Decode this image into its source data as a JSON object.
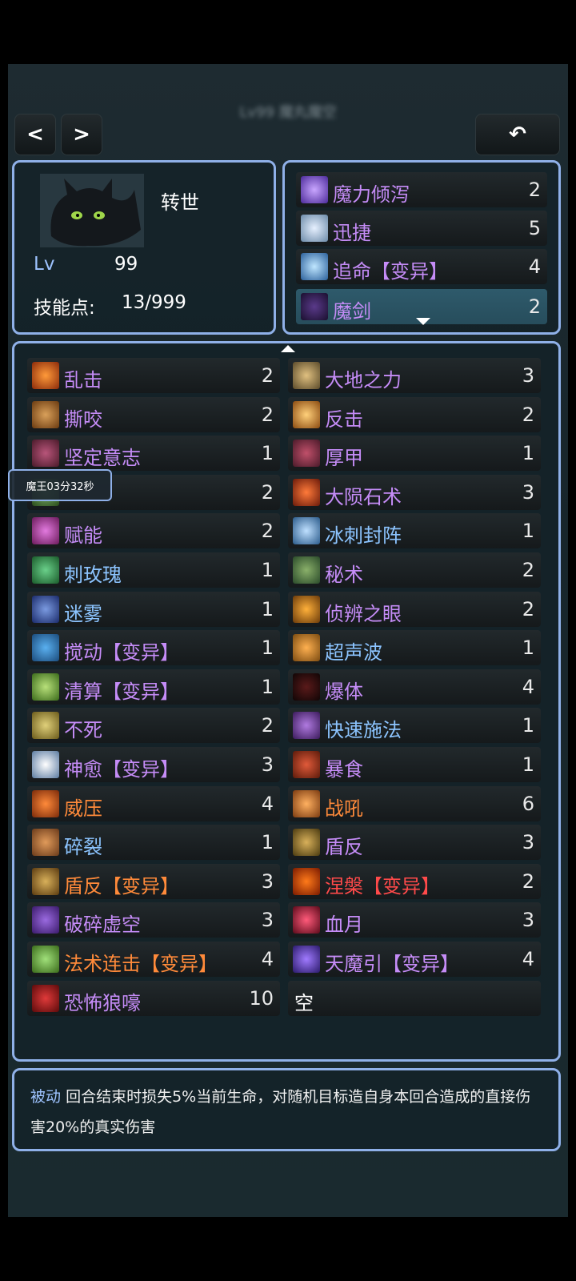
{
  "header": {
    "title": "Lv99 魔丸魔空"
  },
  "nav": {
    "prev": "<",
    "next": ">",
    "back": "↶"
  },
  "hero": {
    "rebirth": "转世",
    "lv_label": "Lv",
    "lv_value": "99",
    "sp_label": "技能点:",
    "sp_value": "13/999"
  },
  "active_skills": [
    {
      "name": "魔力倾泻",
      "count": "2",
      "color": "purple",
      "icon": "vortex-icon"
    },
    {
      "name": "迅捷",
      "count": "5",
      "color": "purple",
      "icon": "swift-icon"
    },
    {
      "name": "追命【变异】",
      "count": "4",
      "color": "purple",
      "icon": "chase-icon"
    },
    {
      "name": "魔剑",
      "count": "2",
      "color": "purple",
      "icon": "demon-sword-icon"
    }
  ],
  "passive_left": [
    {
      "name": "乱击",
      "count": "2",
      "color": "purple"
    },
    {
      "name": "撕咬",
      "count": "2",
      "color": "purple"
    },
    {
      "name": "坚定意志",
      "count": "1",
      "color": "purple"
    },
    {
      "name": "",
      "count": "2",
      "color": "purple"
    },
    {
      "name": "赋能",
      "count": "2",
      "color": "purple"
    },
    {
      "name": "刺玫瑰",
      "count": "1",
      "color": "blue"
    },
    {
      "name": "迷雾",
      "count": "1",
      "color": "blue"
    },
    {
      "name": "搅动【变异】",
      "count": "1",
      "color": "purple"
    },
    {
      "name": "清算【变异】",
      "count": "1",
      "color": "purple"
    },
    {
      "name": "不死",
      "count": "2",
      "color": "purple"
    },
    {
      "name": "神愈【变异】",
      "count": "3",
      "color": "purple"
    },
    {
      "name": "威压",
      "count": "4",
      "color": "orange"
    },
    {
      "name": "碎裂",
      "count": "1",
      "color": "blue"
    },
    {
      "name": "盾反【变异】",
      "count": "3",
      "color": "orange"
    },
    {
      "name": "破碎虚空",
      "count": "3",
      "color": "purple"
    },
    {
      "name": "法术连击【变异】",
      "count": "4",
      "color": "orange"
    },
    {
      "name": "恐怖狼嚎",
      "count": "10",
      "color": "purple"
    }
  ],
  "passive_right": [
    {
      "name": "大地之力",
      "count": "3",
      "color": "purple"
    },
    {
      "name": "反击",
      "count": "2",
      "color": "purple"
    },
    {
      "name": "厚甲",
      "count": "1",
      "color": "purple"
    },
    {
      "name": "大陨石术",
      "count": "3",
      "color": "purple"
    },
    {
      "name": "冰刺封阵",
      "count": "1",
      "color": "blue"
    },
    {
      "name": "秘术",
      "count": "2",
      "color": "purple"
    },
    {
      "name": "侦辨之眼",
      "count": "2",
      "color": "purple"
    },
    {
      "name": "超声波",
      "count": "1",
      "color": "blue"
    },
    {
      "name": "爆体",
      "count": "4",
      "color": "purple"
    },
    {
      "name": "快速施法",
      "count": "1",
      "color": "blue"
    },
    {
      "name": "暴食",
      "count": "1",
      "color": "purple"
    },
    {
      "name": "战吼",
      "count": "6",
      "color": "orange"
    },
    {
      "name": "盾反",
      "count": "3",
      "color": "purple"
    },
    {
      "name": "涅槃【变异】",
      "count": "2",
      "color": "red"
    },
    {
      "name": "血月",
      "count": "3",
      "color": "purple"
    },
    {
      "name": "天魔引【变异】",
      "count": "4",
      "color": "purple"
    },
    {
      "name": "空",
      "count": "",
      "color": "white"
    }
  ],
  "tooltip": {
    "text": "魔王03分32秒"
  },
  "description": {
    "tag": "被动",
    "text": "回合结束时损失5%当前生命，对随机目标造自身本回合造成的直接伤害20%的真实伤害"
  }
}
